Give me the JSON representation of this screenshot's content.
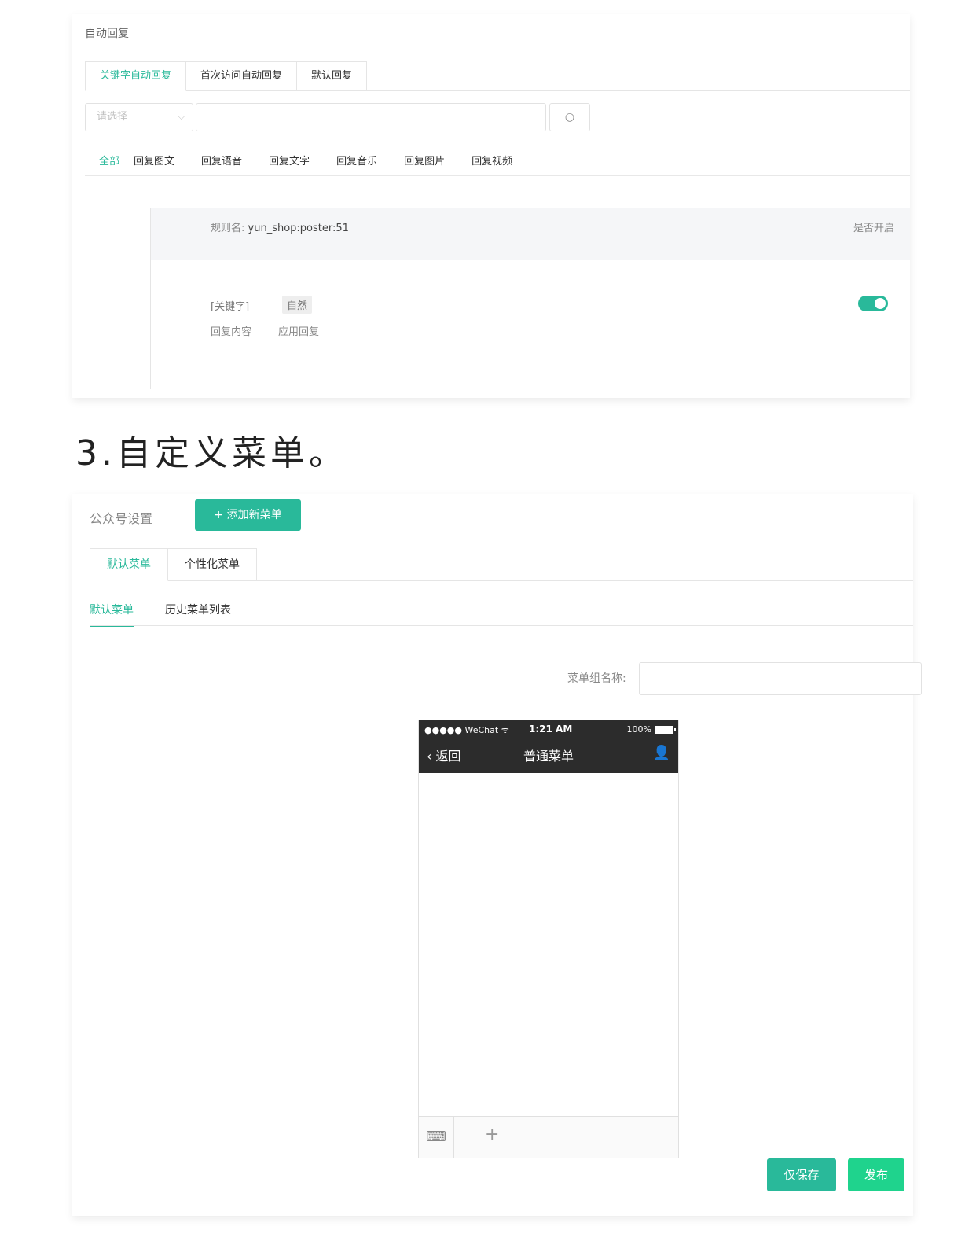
{
  "auto_reply": {
    "title": "自动回复",
    "tabs": [
      {
        "label": "关键字自动回复"
      },
      {
        "label": "首次访问自动回复"
      },
      {
        "label": "默认回复"
      }
    ],
    "select_placeholder": "请选择",
    "filters": [
      {
        "label": "全部"
      },
      {
        "label": "回复图文"
      },
      {
        "label": "回复语音"
      },
      {
        "label": "回复文字"
      },
      {
        "label": "回复音乐"
      },
      {
        "label": "回复图片"
      },
      {
        "label": "回复视频"
      }
    ],
    "rule": {
      "name_label": "规则名:",
      "name_value": "yun_shop:poster:51",
      "open_label": "是否开启",
      "keyword_label": "[关键字]",
      "keyword_value": "自然",
      "reply_label": "回复内容",
      "reply_value": "应用回复",
      "enabled": true
    }
  },
  "section_heading": "3.自定义菜单。",
  "custom_menu": {
    "title": "公众号设置",
    "add_button": "+ 添加新菜单",
    "tabs": [
      {
        "label": "默认菜单"
      },
      {
        "label": "个性化菜单"
      }
    ],
    "subtabs": [
      {
        "label": "默认菜单"
      },
      {
        "label": "历史菜单列表"
      }
    ],
    "group_name_label": "菜单组名称:",
    "phone": {
      "status_left": "●●●●● WeChat ᯤ",
      "time": "1:21 AM",
      "battery": "100%",
      "back_label": "‹ 返回",
      "nav_title": "普通菜单"
    },
    "save_button": "仅保存",
    "publish_button": "发布"
  },
  "colors": {
    "accent": "#29b99a",
    "publish": "#1fd38d"
  }
}
